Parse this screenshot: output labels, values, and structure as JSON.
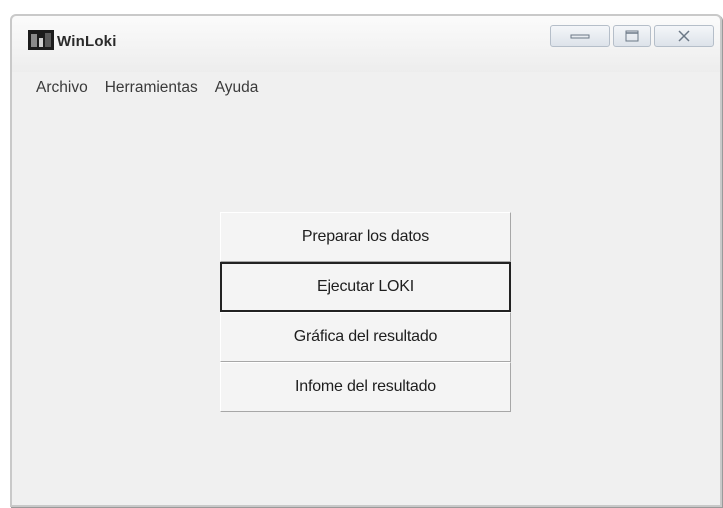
{
  "window": {
    "title": "WinLoki"
  },
  "menubar": {
    "items": [
      {
        "label": "Archivo"
      },
      {
        "label": "Herramientas"
      },
      {
        "label": "Ayuda"
      }
    ]
  },
  "main": {
    "buttons": [
      {
        "label": "Preparar los datos"
      },
      {
        "label": "Ejecutar LOKI"
      },
      {
        "label": "Gráfica del resultado"
      },
      {
        "label": "Infome del resultado"
      }
    ]
  }
}
